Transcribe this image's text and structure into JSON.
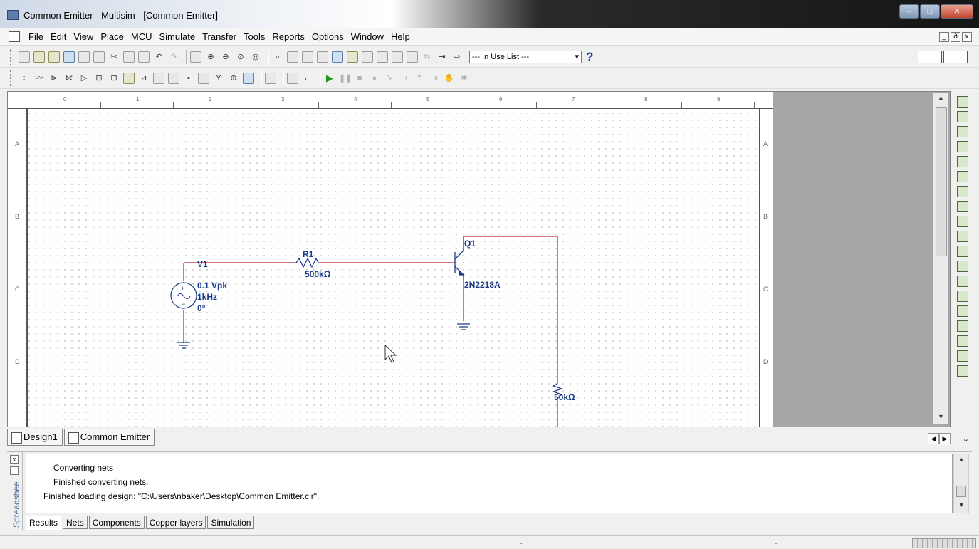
{
  "window": {
    "title": "Common Emitter - Multisim - [Common Emitter]",
    "minimize": "–",
    "maximize": "□",
    "close": "✕"
  },
  "menu": {
    "items": [
      "File",
      "Edit",
      "View",
      "Place",
      "MCU",
      "Simulate",
      "Transfer",
      "Tools",
      "Reports",
      "Options",
      "Window",
      "Help"
    ],
    "mdi_min": "_",
    "mdi_restore": "ð",
    "mdi_close": "x"
  },
  "toolbar": {
    "in_use_list": "--- In Use List ---",
    "help_label": "?"
  },
  "ruler": {
    "top": [
      "0",
      "1",
      "2",
      "3",
      "4",
      "5",
      "6",
      "7",
      "8",
      "9"
    ],
    "side": [
      "A",
      "B",
      "C",
      "D"
    ]
  },
  "schematic": {
    "v1": {
      "name": "V1",
      "amplitude": "0.1 Vpk",
      "frequency": "1kHz",
      "phase": "0°"
    },
    "r1": {
      "name": "R1",
      "value": "500kΩ"
    },
    "q1": {
      "name": "Q1",
      "model": "2N2218A"
    },
    "r2": {
      "value": "50kΩ"
    },
    "wire_color": "#c8283a",
    "label_color": "#1a3a8a"
  },
  "doc_tabs": [
    "Design1",
    "Common Emitter"
  ],
  "spreadsheet": {
    "vertical_label": "Spreadshee",
    "close_label": "x",
    "pin_label": "-",
    "results_lines": [
      "Converting nets",
      "Finished converting nets.",
      "Finished loading design: \"C:\\Users\\nbaker\\Desktop\\Common Emitter.cir\"."
    ],
    "tabs": [
      "Results",
      "Nets",
      "Components",
      "Copper layers",
      "Simulation"
    ]
  },
  "statusbar": {
    "sep1": "-",
    "sep2": "-"
  }
}
